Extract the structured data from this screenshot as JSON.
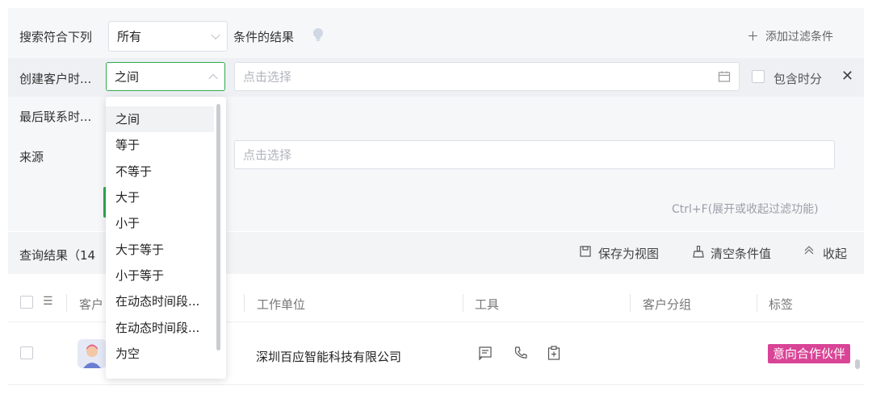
{
  "filter": {
    "header_prefix": "搜索符合下列",
    "match_value": "所有",
    "header_suffix": "条件的结果",
    "add_filter": "添加过滤条件",
    "rows": [
      {
        "label": "创建客户时...",
        "operator": "之间",
        "placeholder": "点击选择",
        "include_time": "包含时分"
      },
      {
        "label": "最后联系时..."
      },
      {
        "label": "来源",
        "placeholder": "点击选择"
      }
    ],
    "shortcut_hint": "Ctrl+F(展开或收起过滤功能)"
  },
  "operator_options": [
    "之间",
    "等于",
    "不等于",
    "大于",
    "小于",
    "大于等于",
    "小于等于",
    "在动态时间段...",
    "在动态时间段...",
    "为空"
  ],
  "results": {
    "label": "查询结果（14",
    "save_view": "保存为视图",
    "clear": "清空条件值",
    "collapse": "收起"
  },
  "table": {
    "columns": [
      "客户",
      "工作单位",
      "工具",
      "客户分组",
      "标签"
    ],
    "rows": [
      {
        "company": "深圳百应智能科技有限公司",
        "tag": "意向合作伙伴"
      }
    ]
  },
  "colors": {
    "accent": "#2eaa4e",
    "tag": "#d94496"
  }
}
